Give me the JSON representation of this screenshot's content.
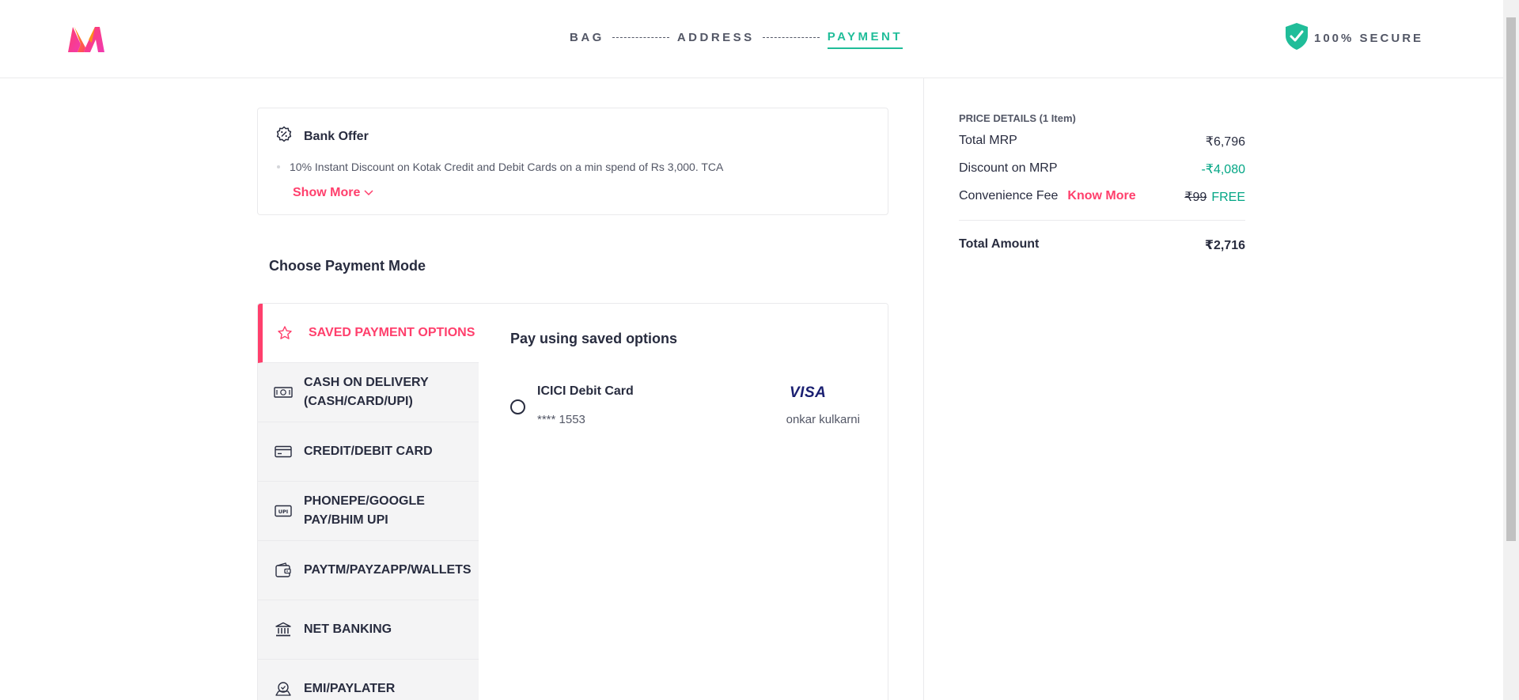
{
  "header": {
    "steps": [
      {
        "label": "BAG",
        "active": false
      },
      {
        "label": "ADDRESS",
        "active": false
      },
      {
        "label": "PAYMENT",
        "active": true
      }
    ],
    "secure_label": "100% SECURE"
  },
  "bank_offer": {
    "title": "Bank Offer",
    "items": [
      "10% Instant Discount on Kotak Credit and Debit Cards on a min spend of Rs 3,000. TCA"
    ],
    "show_more_label": "Show More"
  },
  "payment": {
    "title": "Choose Payment Mode",
    "tabs": [
      {
        "label": "SAVED PAYMENT OPTIONS",
        "icon": "star-icon",
        "active": true
      },
      {
        "label": "CASH ON DELIVERY (CASH/CARD/UPI)",
        "icon": "cash-icon"
      },
      {
        "label": "CREDIT/DEBIT CARD",
        "icon": "card-icon"
      },
      {
        "label": "PHONEPE/GOOGLE PAY/BHIM UPI",
        "icon": "upi-icon"
      },
      {
        "label": "PAYTM/PAYZAPP/WALLETS",
        "icon": "wallet-icon"
      },
      {
        "label": "NET BANKING",
        "icon": "bank-icon"
      },
      {
        "label": "EMI/PAYLATER",
        "icon": "emi-icon"
      }
    ],
    "saved": {
      "title": "Pay using saved options",
      "card": {
        "name": "ICICI Debit Card",
        "number": "**** 1553",
        "network": "VISA",
        "holder": "onkar kulkarni"
      }
    }
  },
  "price_details": {
    "title": "PRICE DETAILS (1 Item)",
    "total_mrp_label": "Total MRP",
    "total_mrp_value": "₹6,796",
    "discount_label": "Discount on MRP",
    "discount_value": "-₹4,080",
    "fee_label": "Convenience Fee",
    "fee_link": "Know More",
    "fee_original": "₹99",
    "fee_value": "FREE",
    "total_label": "Total Amount",
    "total_value": "₹2,716"
  },
  "colors": {
    "accent": "#ff3f6c",
    "green": "#03a685",
    "step_active": "#20bd99",
    "text": "#282c3f"
  }
}
